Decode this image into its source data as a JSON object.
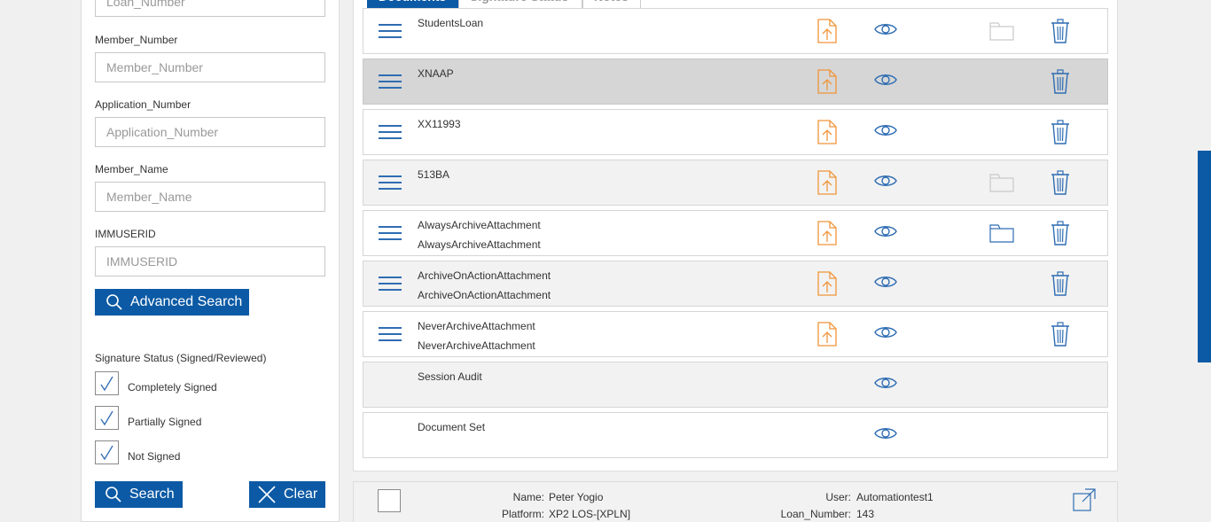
{
  "search_panel": {
    "fields": [
      {
        "id": "loan_number",
        "label": "",
        "placeholder": "Loan_Number"
      },
      {
        "id": "member_number",
        "label": "Member_Number",
        "placeholder": "Member_Number"
      },
      {
        "id": "application_number",
        "label": "Application_Number",
        "placeholder": "Application_Number"
      },
      {
        "id": "member_name",
        "label": "Member_Name",
        "placeholder": "Member_Name"
      },
      {
        "id": "immuserid",
        "label": "IMMUSERID",
        "placeholder": "IMMUSERID"
      }
    ],
    "advanced_search_label": "Advanced Search",
    "signature_status_label": "Signature Status (Signed/Reviewed)",
    "checkboxes": [
      {
        "label": "Completely Signed",
        "checked": true
      },
      {
        "label": "Partially Signed",
        "checked": true
      },
      {
        "label": "Not Signed",
        "checked": true
      }
    ],
    "search_label": "Search",
    "clear_label": "Clear"
  },
  "tabs": [
    "Documents",
    "Signature Status",
    "Notes"
  ],
  "documents": [
    {
      "name": "StudentsLoan",
      "sub": "",
      "handle": true,
      "upload": true,
      "folder": "light",
      "trash": true,
      "style": "normal"
    },
    {
      "name": "XNAAP",
      "sub": "",
      "handle": true,
      "upload": true,
      "folder": "none",
      "trash": true,
      "style": "selected"
    },
    {
      "name": "XX11993",
      "sub": "",
      "handle": true,
      "upload": true,
      "folder": "none",
      "trash": true,
      "style": "normal"
    },
    {
      "name": "513BA",
      "sub": "",
      "handle": true,
      "upload": true,
      "folder": "light",
      "trash": true,
      "style": "alt"
    },
    {
      "name": "AlwaysArchiveAttachment",
      "sub": "AlwaysArchiveAttachment",
      "handle": true,
      "upload": true,
      "folder": "blue",
      "trash": true,
      "style": "normal"
    },
    {
      "name": "ArchiveOnActionAttachment",
      "sub": "ArchiveOnActionAttachment",
      "handle": true,
      "upload": true,
      "folder": "none",
      "trash": true,
      "style": "alt"
    },
    {
      "name": "NeverArchiveAttachment",
      "sub": "NeverArchiveAttachment",
      "handle": true,
      "upload": true,
      "folder": "none",
      "trash": true,
      "style": "normal"
    },
    {
      "name": "Session Audit",
      "sub": "",
      "handle": false,
      "upload": false,
      "folder": "none",
      "trash": false,
      "style": "alt"
    },
    {
      "name": "Document Set",
      "sub": "",
      "handle": false,
      "upload": false,
      "folder": "none",
      "trash": false,
      "style": "normal"
    }
  ],
  "info": {
    "name_key": "Name:",
    "name_value": "Peter Yogio",
    "platform_key": "Platform:",
    "platform_value": "XP2 LOS-[XPLN]",
    "user_key": "User:",
    "user_value": "Automationtest1",
    "loan_key": "Loan_Number:",
    "loan_value": "143"
  },
  "colors": {
    "primary": "#0c5aa5",
    "upload_orange": "#f0953a",
    "icon_blue": "#2f6db3",
    "folder_light": "#c9c9c9"
  }
}
